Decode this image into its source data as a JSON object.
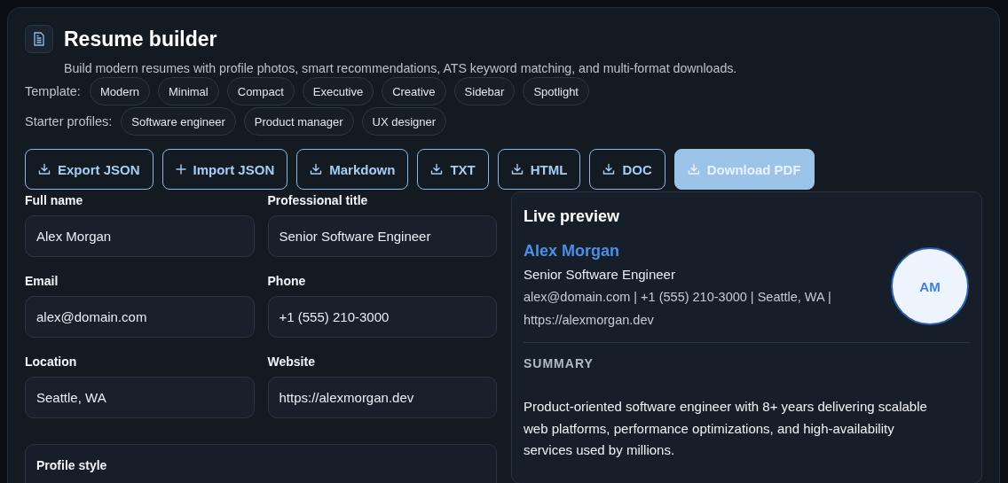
{
  "header": {
    "title": "Resume builder",
    "subtitle": "Build modern resumes with profile photos, smart recommendations, ATS keyword matching, and multi-format downloads."
  },
  "template_row": {
    "label": "Template:",
    "options": [
      {
        "label": "Modern",
        "selected": false
      },
      {
        "label": "Minimal",
        "selected": false
      },
      {
        "label": "Compact",
        "selected": false
      },
      {
        "label": "Executive",
        "selected": false
      },
      {
        "label": "Creative",
        "selected": false
      },
      {
        "label": "Sidebar",
        "selected": false
      },
      {
        "label": "Spotlight",
        "selected": false
      }
    ]
  },
  "starter_row": {
    "label": "Starter profiles:",
    "options": [
      {
        "label": "Software engineer"
      },
      {
        "label": "Product manager"
      },
      {
        "label": "UX designer"
      }
    ]
  },
  "actions": [
    {
      "label": "Export JSON",
      "kind": "download"
    },
    {
      "label": "Import JSON",
      "kind": "add"
    },
    {
      "label": "Markdown",
      "kind": "download"
    },
    {
      "label": "TXT",
      "kind": "download"
    },
    {
      "label": "HTML",
      "kind": "download"
    },
    {
      "label": "DOC",
      "kind": "download"
    },
    {
      "label": "Download PDF",
      "kind": "primary"
    }
  ],
  "form": {
    "fields": [
      {
        "label": "Full name",
        "value": "Alex Morgan"
      },
      {
        "label": "Professional title",
        "value": "Senior Software Engineer"
      },
      {
        "label": "Email",
        "value": "alex@domain.com"
      },
      {
        "label": "Phone",
        "value": "+1 (555) 210-3000"
      },
      {
        "label": "Location",
        "value": "Seattle, WA"
      },
      {
        "label": "Website",
        "value": "https://alexmorgan.dev"
      }
    ],
    "profile_style": {
      "title": "Profile style"
    }
  },
  "preview": {
    "title": "Live preview",
    "name": "Alex Morgan",
    "headline": "Senior Software Engineer",
    "contact": "alex@domain.com | +1 (555) 210-3000 | Seattle, WA | https://alexmorgan.dev",
    "avatar_initials": "AM",
    "sections": [
      {
        "heading": "SUMMARY",
        "body": "Product-oriented software engineer with 8+ years delivering scalable web platforms, performance optimizations, and high-availability services used by millions."
      }
    ]
  }
}
